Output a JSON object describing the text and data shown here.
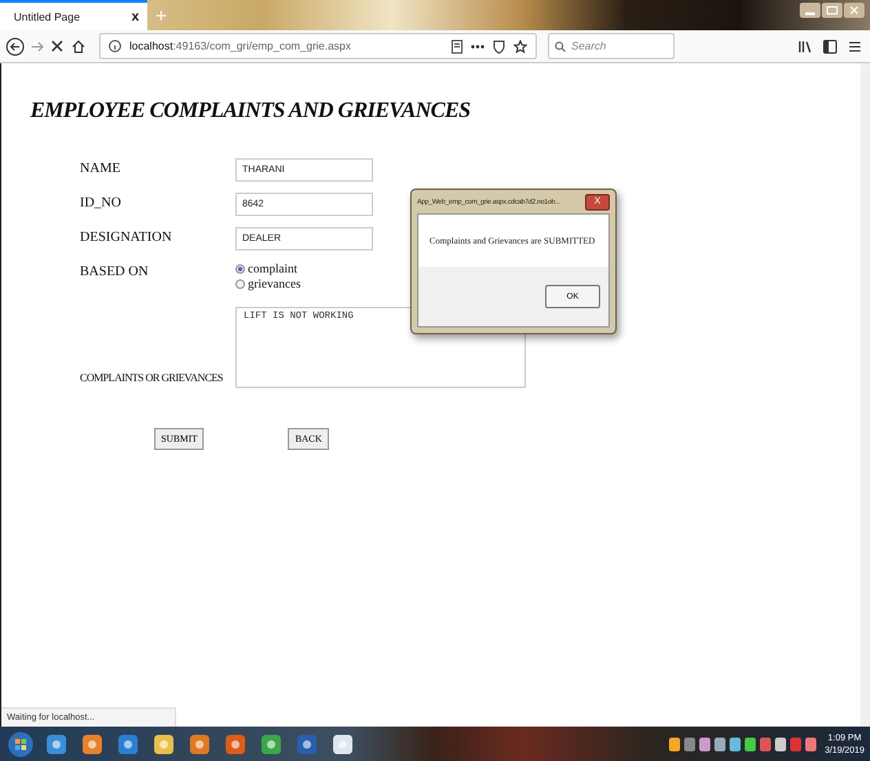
{
  "browser": {
    "tab": {
      "title": "Untitled Page",
      "close": "x",
      "new_tab": "+"
    },
    "url": "**localhost**:49163/com_gri/emp_com_grie.aspx",
    "search": {
      "placeholder": "Search"
    }
  },
  "page": {
    "heading": "EMPLOYEE COMPLAINTS AND GRIEVANCES",
    "fields": [
      {
        "label": "NAME",
        "value": "THARANI"
      },
      {
        "label": "ID_NO",
        "value": "8642"
      },
      {
        "label": "DESIGNATION",
        "value": "DEALER"
      }
    ],
    "based_on": {
      "label": "BASED ON",
      "options": [
        {
          "label": "complaint",
          "selected": true
        },
        {
          "label": "grievances",
          "selected": false
        }
      ]
    },
    "complaint": {
      "label": "COMPLAINTS OR GRIEVANCES",
      "value": "LIFT IS NOT WORKING"
    },
    "buttons": [
      "SUBMIT",
      "BACK"
    ]
  },
  "dialog": {
    "title": "App_Web_emp_com_grie.aspx.cdcab7d2.no1ob...",
    "close": "X",
    "message": "Complaints and Grievances are SUBMITTED",
    "ok": "OK"
  },
  "status_bar": "Waiting for localhost...",
  "taskbar": {
    "time": "1:09 PM",
    "date": "3/19/2019"
  }
}
